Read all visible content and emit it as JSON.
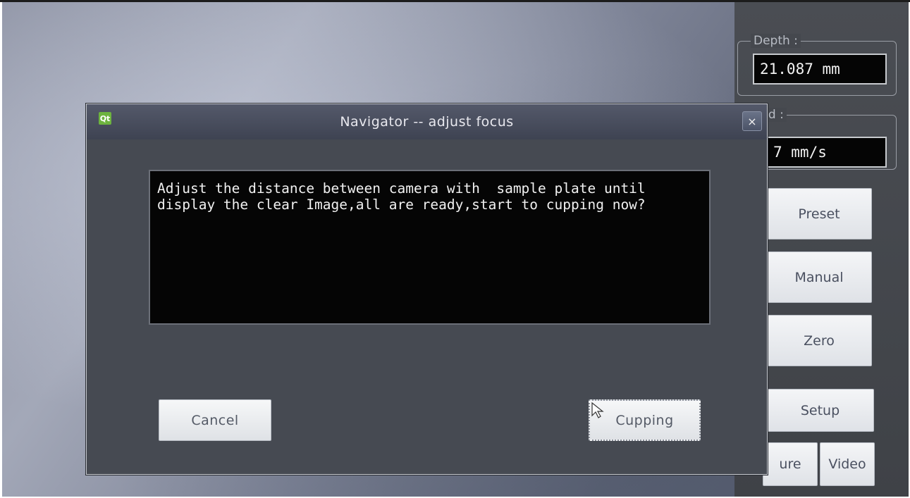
{
  "right_panel": {
    "depth": {
      "label": "Depth :",
      "value": "21.087 mm"
    },
    "speed": {
      "label": "eed :",
      "value": "7 mm/s"
    },
    "buttons": {
      "preset": "Preset",
      "manual": "Manual",
      "zero": "Zero",
      "setup": "Setup",
      "capture": "ure",
      "video": "Video"
    }
  },
  "dialog": {
    "title": "Navigator -- adjust focus",
    "app_icon": "Qt",
    "close_icon": "×",
    "message": "Adjust the distance between camera with  sample plate until\ndisplay the clear Image,all are ready,start to cupping now?",
    "buttons": {
      "cancel": "Cancel",
      "cupping": "Cupping"
    }
  },
  "colors": {
    "dialog_bg": "#464a52",
    "message_bg": "#050505",
    "qt_green": "#6db33f"
  }
}
